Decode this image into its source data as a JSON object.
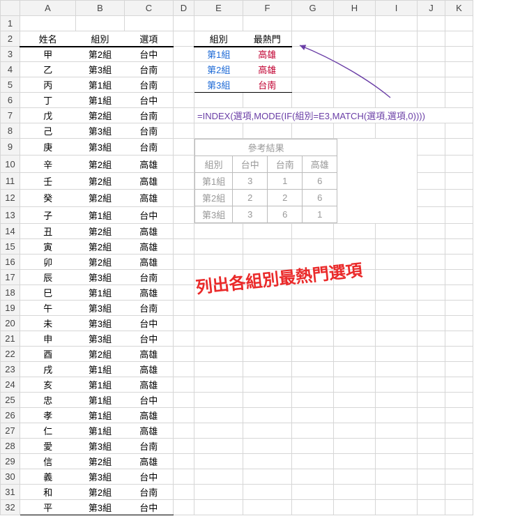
{
  "columns": [
    "A",
    "B",
    "C",
    "D",
    "E",
    "F",
    "G",
    "H",
    "I",
    "J",
    "K"
  ],
  "row_numbers": [
    1,
    2,
    3,
    4,
    5,
    6,
    7,
    8,
    9,
    10,
    11,
    12,
    13,
    14,
    15,
    16,
    17,
    18,
    19,
    20,
    21,
    22,
    23,
    24,
    25,
    26,
    27,
    28,
    29,
    30,
    31,
    32
  ],
  "main": {
    "headers": {
      "name": "姓名",
      "group": "組別",
      "option": "選項"
    },
    "rows": [
      {
        "n": "甲",
        "g": "第2組",
        "o": "台中"
      },
      {
        "n": "乙",
        "g": "第3組",
        "o": "台南"
      },
      {
        "n": "丙",
        "g": "第1組",
        "o": "台南"
      },
      {
        "n": "丁",
        "g": "第1組",
        "o": "台中"
      },
      {
        "n": "戊",
        "g": "第2組",
        "o": "台南"
      },
      {
        "n": "己",
        "g": "第3組",
        "o": "台南"
      },
      {
        "n": "庚",
        "g": "第3組",
        "o": "台南"
      },
      {
        "n": "辛",
        "g": "第2組",
        "o": "高雄"
      },
      {
        "n": "壬",
        "g": "第2組",
        "o": "高雄"
      },
      {
        "n": "癸",
        "g": "第2組",
        "o": "高雄"
      },
      {
        "n": "子",
        "g": "第1組",
        "o": "台中"
      },
      {
        "n": "丑",
        "g": "第2組",
        "o": "高雄"
      },
      {
        "n": "寅",
        "g": "第2組",
        "o": "高雄"
      },
      {
        "n": "卯",
        "g": "第2組",
        "o": "高雄"
      },
      {
        "n": "辰",
        "g": "第3組",
        "o": "台南"
      },
      {
        "n": "巳",
        "g": "第1組",
        "o": "高雄"
      },
      {
        "n": "午",
        "g": "第3組",
        "o": "台南"
      },
      {
        "n": "未",
        "g": "第3組",
        "o": "台中"
      },
      {
        "n": "申",
        "g": "第3組",
        "o": "台中"
      },
      {
        "n": "酉",
        "g": "第2組",
        "o": "高雄"
      },
      {
        "n": "戌",
        "g": "第1組",
        "o": "高雄"
      },
      {
        "n": "亥",
        "g": "第1組",
        "o": "高雄"
      },
      {
        "n": "忠",
        "g": "第1組",
        "o": "台中"
      },
      {
        "n": "孝",
        "g": "第1組",
        "o": "高雄"
      },
      {
        "n": "仁",
        "g": "第1組",
        "o": "高雄"
      },
      {
        "n": "愛",
        "g": "第3組",
        "o": "台南"
      },
      {
        "n": "信",
        "g": "第2組",
        "o": "高雄"
      },
      {
        "n": "義",
        "g": "第3組",
        "o": "台中"
      },
      {
        "n": "和",
        "g": "第2組",
        "o": "台南"
      },
      {
        "n": "平",
        "g": "第3組",
        "o": "台中"
      }
    ]
  },
  "result": {
    "headers": {
      "group": "組別",
      "top": "最熱門"
    },
    "rows": [
      {
        "g": "第1組",
        "t": "高雄"
      },
      {
        "g": "第2組",
        "t": "高雄"
      },
      {
        "g": "第3組",
        "t": "台南"
      }
    ]
  },
  "formula": "=INDEX(選項,MODE(IF(組別=E3,MATCH(選項,選項,0))))",
  "pivot": {
    "title": "參考結果",
    "col_hdr": "組別",
    "cols": [
      "台中",
      "台南",
      "高雄"
    ],
    "rows": [
      {
        "g": "第1組",
        "v": [
          "3",
          "1",
          "6"
        ]
      },
      {
        "g": "第2組",
        "v": [
          "2",
          "2",
          "6"
        ]
      },
      {
        "g": "第3組",
        "v": [
          "3",
          "6",
          "1"
        ]
      }
    ]
  },
  "banner": "列出各組別最熱門選項"
}
